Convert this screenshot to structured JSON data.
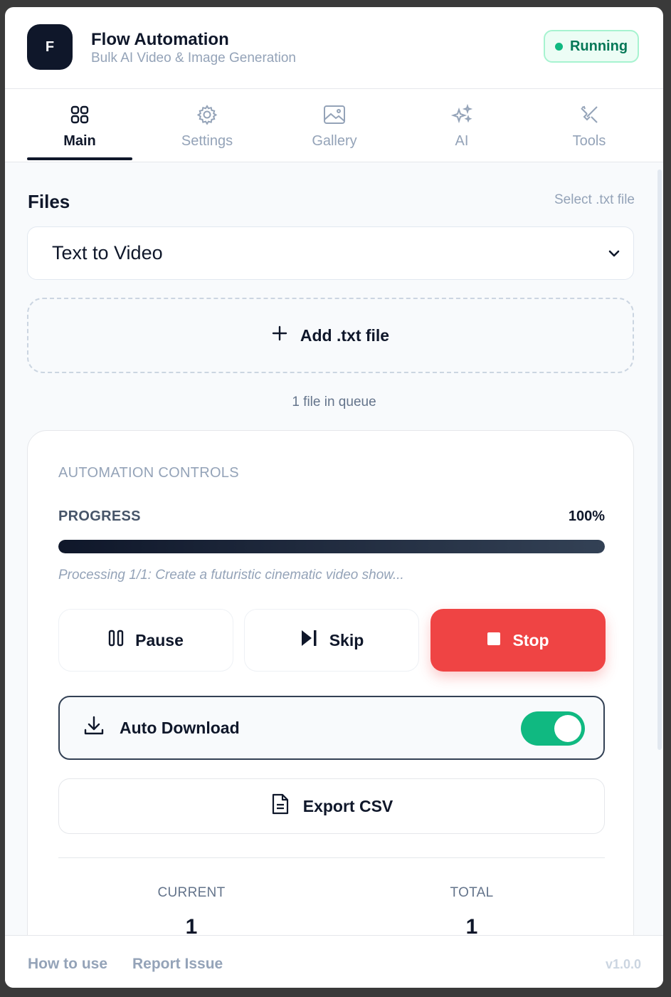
{
  "app": {
    "logo_letter": "F",
    "title": "Flow Automation",
    "subtitle": "Bulk AI Video & Image Generation",
    "status": "Running"
  },
  "tabs": [
    {
      "label": "Main",
      "icon": "grid-icon",
      "active": true
    },
    {
      "label": "Settings",
      "icon": "gear-icon",
      "active": false
    },
    {
      "label": "Gallery",
      "icon": "image-icon",
      "active": false
    },
    {
      "label": "AI",
      "icon": "sparkles-icon",
      "active": false
    },
    {
      "label": "Tools",
      "icon": "tools-icon",
      "active": false
    }
  ],
  "files": {
    "title": "Files",
    "select_link": "Select .txt file",
    "mode_selected": "Text to Video",
    "add_button": "Add .txt file",
    "queue_text": "1 file in queue"
  },
  "automation": {
    "title": "AUTOMATION CONTROLS",
    "progress_label": "PROGRESS",
    "progress_value": "100%",
    "progress_fraction": 1.0,
    "processing_text": "Processing 1/1: Create a futuristic cinematic video show...",
    "pause_label": "Pause",
    "skip_label": "Skip",
    "stop_label": "Stop",
    "auto_download_label": "Auto Download",
    "auto_download_on": true,
    "export_label": "Export CSV",
    "current_label": "CURRENT",
    "current_value": "1",
    "total_label": "TOTAL",
    "total_value": "1"
  },
  "footer": {
    "how_to_use": "How to use",
    "report_issue": "Report Issue",
    "version": "v1.0.0"
  },
  "colors": {
    "accent_dark": "#0f172a",
    "running_green": "#10b981",
    "stop_red": "#ef4444"
  }
}
